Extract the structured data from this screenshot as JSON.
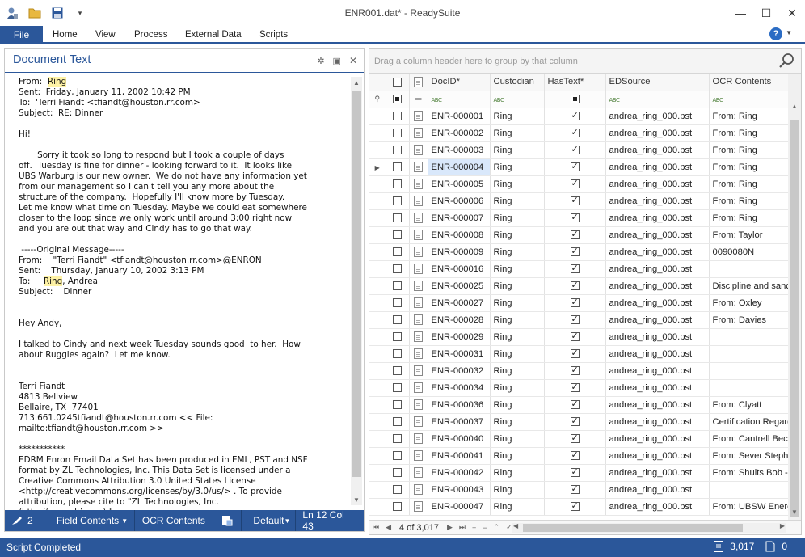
{
  "window": {
    "title": "ENR001.dat* - ReadySuite",
    "minimize": "—",
    "maximize": "☐",
    "close": "✕"
  },
  "qat": {
    "dropdown": "▾"
  },
  "ribbon": {
    "file": "File",
    "tabs": [
      "Home",
      "View",
      "Process",
      "External Data",
      "Scripts"
    ],
    "help": "?"
  },
  "doc_panel": {
    "title": "Document Text",
    "pin": "✲",
    "dock": "▣",
    "close": "✕",
    "highlight_word": "Ring",
    "lines": [
      {
        "pre": "From:  ",
        "hl": "Ring",
        "post": ""
      },
      {
        "pre": "Sent:  Friday, January 11, 2002 10:42 PM"
      },
      {
        "pre": "To:  'Terri Fiandt <tfiandt@houston.rr.com>"
      },
      {
        "pre": "Subject:  RE: Dinner"
      },
      {
        "pre": ""
      },
      {
        "pre": "Hi!"
      },
      {
        "pre": ""
      },
      {
        "pre": "       Sorry it took so long to respond but I took a couple of days"
      },
      {
        "pre": "off.  Tuesday is fine for dinner - looking forward to it.  It looks like"
      },
      {
        "pre": "UBS Warburg is our new owner.  We do not have any information yet"
      },
      {
        "pre": "from our management so I can't tell you any more about the"
      },
      {
        "pre": "structure of the company.  Hopefully I'll know more by Tuesday."
      },
      {
        "pre": "Let me know what time on Tuesday. Maybe we could eat somewhere"
      },
      {
        "pre": "closer to the loop since we only work until around 3:00 right now"
      },
      {
        "pre": "and you are out that way and Cindy has to go that way."
      },
      {
        "pre": ""
      },
      {
        "pre": " -----Original Message-----"
      },
      {
        "pre": "From:    \"Terri Fiandt\" <tfiandt@houston.rr.com>@ENRON"
      },
      {
        "pre": "Sent:    Thursday, January 10, 2002 3:13 PM"
      },
      {
        "pre": "To:     ",
        "hl": "Ring",
        "post": ", Andrea"
      },
      {
        "pre": "Subject:    Dinner"
      },
      {
        "pre": ""
      },
      {
        "pre": ""
      },
      {
        "pre": "Hey Andy,"
      },
      {
        "pre": ""
      },
      {
        "pre": "I talked to Cindy and next week Tuesday sounds good  to her.  How"
      },
      {
        "pre": "about Ruggles again?  Let me know."
      },
      {
        "pre": ""
      },
      {
        "pre": ""
      },
      {
        "pre": "Terri Fiandt"
      },
      {
        "pre": "4813 Bellview"
      },
      {
        "pre": "Bellaire, TX  77401"
      },
      {
        "pre": "713.661.0245tfiandt@houston.rr.com << File:"
      },
      {
        "pre": "mailto:tfiandt@houston.rr.com >>"
      },
      {
        "pre": ""
      },
      {
        "pre": "***********"
      },
      {
        "pre": "EDRM Enron Email Data Set has been produced in EML, PST and NSF"
      },
      {
        "pre": "format by ZL Technologies, Inc. This Data Set is licensed under a"
      },
      {
        "pre": "Creative Commons Attribution 3.0 United States License"
      },
      {
        "pre": "<http://creativecommons.org/licenses/by/3.0/us/> . To provide"
      },
      {
        "pre": "attribution, please cite to \"ZL Technologies, Inc."
      },
      {
        "pre": "(http://www.zlti.com).\""
      }
    ],
    "status": {
      "hits": "2",
      "field_contents": "Field Contents",
      "ocr_contents": "OCR Contents",
      "view": "Default",
      "position": "Ln 12 Col 43"
    }
  },
  "grid": {
    "group_hint": "Drag a column header here to group by that column",
    "columns": [
      "DocID*",
      "Custodian",
      "HasText*",
      "EDSource",
      "OCR Contents"
    ],
    "filter_icon": "ABC",
    "rows": [
      {
        "docid": "ENR-000001",
        "custodian": "Ring",
        "hastext": true,
        "source": "andrea_ring_000.pst",
        "ocr": "From:  Ring"
      },
      {
        "docid": "ENR-000002",
        "custodian": "Ring",
        "hastext": true,
        "source": "andrea_ring_000.pst",
        "ocr": "From:  Ring"
      },
      {
        "docid": "ENR-000003",
        "custodian": "Ring",
        "hastext": true,
        "source": "andrea_ring_000.pst",
        "ocr": "From:  Ring"
      },
      {
        "docid": "ENR-000004",
        "custodian": "Ring",
        "hastext": true,
        "source": "andrea_ring_000.pst",
        "ocr": "From:  Ring",
        "selected": true
      },
      {
        "docid": "ENR-000005",
        "custodian": "Ring",
        "hastext": true,
        "source": "andrea_ring_000.pst",
        "ocr": "From:  Ring"
      },
      {
        "docid": "ENR-000006",
        "custodian": "Ring",
        "hastext": true,
        "source": "andrea_ring_000.pst",
        "ocr": "From:  Ring"
      },
      {
        "docid": "ENR-000007",
        "custodian": "Ring",
        "hastext": true,
        "source": "andrea_ring_000.pst",
        "ocr": "From:  Ring"
      },
      {
        "docid": "ENR-000008",
        "custodian": "Ring",
        "hastext": true,
        "source": "andrea_ring_000.pst",
        "ocr": "From:  Taylor"
      },
      {
        "docid": "ENR-000009",
        "custodian": "Ring",
        "hastext": true,
        "source": "andrea_ring_000.pst",
        "ocr": "0090080N"
      },
      {
        "docid": "ENR-000016",
        "custodian": "Ring",
        "hastext": true,
        "source": "andrea_ring_000.pst",
        "ocr": ""
      },
      {
        "docid": "ENR-000025",
        "custodian": "Ring",
        "hastext": true,
        "source": "andrea_ring_000.pst",
        "ocr": "Discipline and sanct"
      },
      {
        "docid": "ENR-000027",
        "custodian": "Ring",
        "hastext": true,
        "source": "andrea_ring_000.pst",
        "ocr": "From:  Oxley"
      },
      {
        "docid": "ENR-000028",
        "custodian": "Ring",
        "hastext": true,
        "source": "andrea_ring_000.pst",
        "ocr": "From:  Davies"
      },
      {
        "docid": "ENR-000029",
        "custodian": "Ring",
        "hastext": true,
        "source": "andrea_ring_000.pst",
        "ocr": ""
      },
      {
        "docid": "ENR-000031",
        "custodian": "Ring",
        "hastext": true,
        "source": "andrea_ring_000.pst",
        "ocr": ""
      },
      {
        "docid": "ENR-000032",
        "custodian": "Ring",
        "hastext": true,
        "source": "andrea_ring_000.pst",
        "ocr": ""
      },
      {
        "docid": "ENR-000034",
        "custodian": "Ring",
        "hastext": true,
        "source": "andrea_ring_000.pst",
        "ocr": ""
      },
      {
        "docid": "ENR-000036",
        "custodian": "Ring",
        "hastext": true,
        "source": "andrea_ring_000.pst",
        "ocr": "From:  Clyatt"
      },
      {
        "docid": "ENR-000037",
        "custodian": "Ring",
        "hastext": true,
        "source": "andrea_ring_000.pst",
        "ocr": "Certification Regard"
      },
      {
        "docid": "ENR-000040",
        "custodian": "Ring",
        "hastext": true,
        "source": "andrea_ring_000.pst",
        "ocr": "From:  Cantrell Bec"
      },
      {
        "docid": "ENR-000041",
        "custodian": "Ring",
        "hastext": true,
        "source": "andrea_ring_000.pst",
        "ocr": "From:  Sever  Steph"
      },
      {
        "docid": "ENR-000042",
        "custodian": "Ring",
        "hastext": true,
        "source": "andrea_ring_000.pst",
        "ocr": "From:  Shults  Bob -"
      },
      {
        "docid": "ENR-000043",
        "custodian": "Ring",
        "hastext": true,
        "source": "andrea_ring_000.pst",
        "ocr": ""
      },
      {
        "docid": "ENR-000047",
        "custodian": "Ring",
        "hastext": true,
        "source": "andrea_ring_000.pst",
        "ocr": "From:  UBSW Energ"
      }
    ],
    "nav": {
      "count": "4 of 3,017",
      "first": "⏮",
      "prev": "◀",
      "next": "▶",
      "last": "⏭",
      "add": "+",
      "remove": "−",
      "edit": "⌃",
      "accept": "✓",
      "cancel": "✗",
      "filter": "⊽"
    }
  },
  "statusbar": {
    "message": "Script Completed",
    "doc_count": "3,017",
    "zero": "0"
  },
  "colors": {
    "accent": "#2b579a",
    "highlight": "#fff3a6",
    "selected_cell": "#d9e8fb"
  }
}
